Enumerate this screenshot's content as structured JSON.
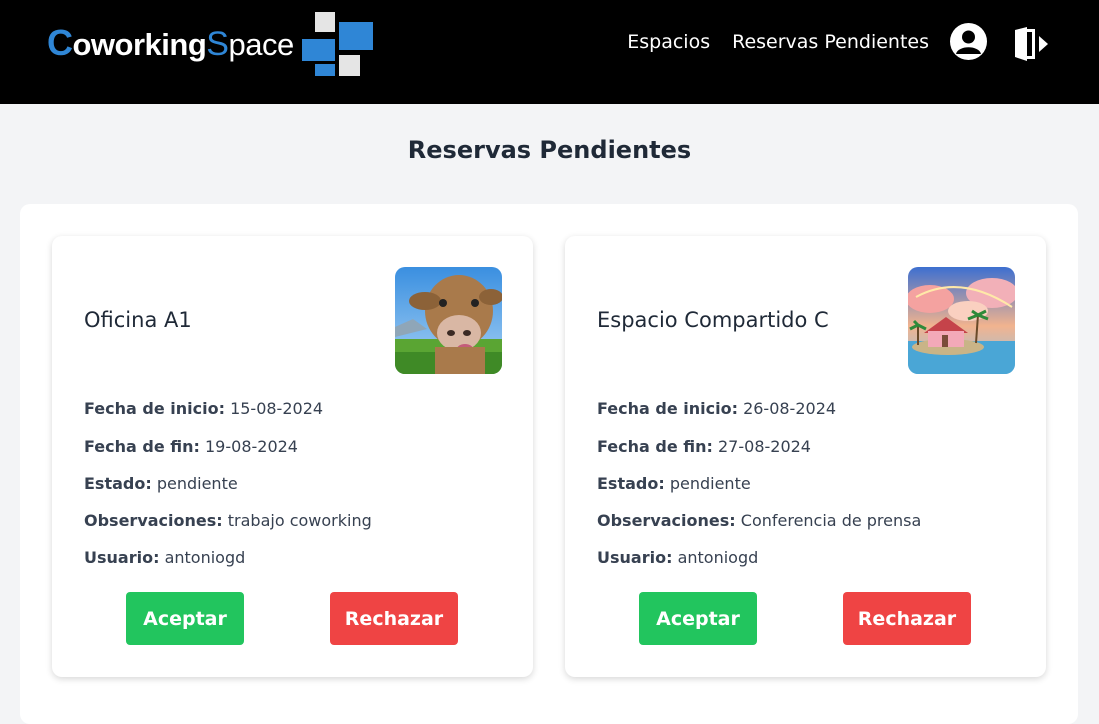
{
  "brand": {
    "part1": "C",
    "part2": "oworking",
    "part3": "S",
    "part4": "pace"
  },
  "nav": {
    "links": [
      {
        "label": "Espacios"
      },
      {
        "label": "Reservas Pendientes"
      }
    ],
    "icons": [
      "user-circle-icon",
      "logout-door-icon"
    ]
  },
  "page_title": "Reservas Pendientes",
  "labels": {
    "start": "Fecha de inicio:",
    "end": "Fecha de fin:",
    "status": "Estado:",
    "notes": "Observaciones:",
    "user": "Usuario:"
  },
  "reservations": [
    {
      "space": "Oficina A1",
      "start": "15-08-2024",
      "end": "19-08-2024",
      "status": "pendiente",
      "notes": "trabajo coworking",
      "user": "antoniogd",
      "accept_label": "Aceptar",
      "reject_label": "Rechazar"
    },
    {
      "space": "Espacio Compartido C",
      "start": "26-08-2024",
      "end": "27-08-2024",
      "status": "pendiente",
      "notes": "Conferencia de prensa",
      "user": "antoniogd",
      "accept_label": "Aceptar",
      "reject_label": "Rechazar"
    }
  ],
  "colors": {
    "navbar": "#000000",
    "brand_blue": "#2f86d6",
    "accept": "#22c55e",
    "reject": "#ef4444",
    "page_bg": "#f3f4f6"
  }
}
